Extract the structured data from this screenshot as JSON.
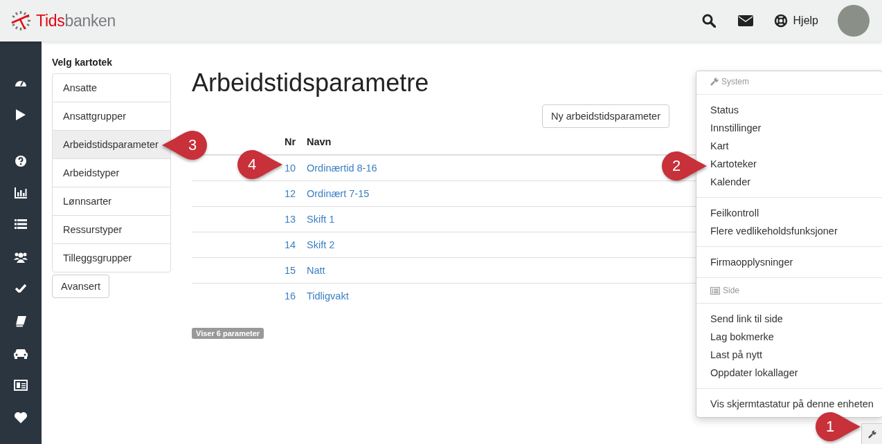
{
  "header": {
    "logo": {
      "part_1": "Tids",
      "part_2": "banken"
    },
    "help_label": "Hjelp"
  },
  "left_panel": {
    "title": "Velg kartotek",
    "items": [
      {
        "label": "Ansatte",
        "selected": false
      },
      {
        "label": "Ansattgrupper",
        "selected": false
      },
      {
        "label": "Arbeidstidsparameter",
        "selected": true
      },
      {
        "label": "Arbeidstyper",
        "selected": false
      },
      {
        "label": "Lønnsarter",
        "selected": false
      },
      {
        "label": "Ressurstyper",
        "selected": false
      },
      {
        "label": "Tilleggsgrupper",
        "selected": false
      }
    ],
    "advanced_button": "Avansert"
  },
  "main": {
    "title": "Arbeidstidsparametre",
    "new_button": "Ny arbeidstidsparameter",
    "table": {
      "columns": [
        "Nr",
        "Navn"
      ],
      "rows": [
        [
          "10",
          "Ordinærtid 8-16"
        ],
        [
          "12",
          "Ordinært 7-15"
        ],
        [
          "13",
          "Skift 1"
        ],
        [
          "14",
          "Skift 2"
        ],
        [
          "15",
          "Natt"
        ],
        [
          "16",
          "Tidligvakt"
        ]
      ]
    },
    "count_badge": "Viser 6 parameter"
  },
  "menu": {
    "groups": [
      {
        "kind": "header",
        "label": "System"
      },
      {
        "kind": "items",
        "items": [
          "Status",
          "Innstillinger",
          "Kart",
          "Kartoteker",
          "Kalender"
        ]
      },
      {
        "kind": "items",
        "items": [
          "Feilkontroll",
          "Flere vedlikeholdsfunksjoner"
        ]
      },
      {
        "kind": "items",
        "items": [
          "Firmaopplysninger"
        ]
      },
      {
        "kind": "header",
        "label": "Side"
      },
      {
        "kind": "items",
        "items": [
          "Send link til side",
          "Lag bokmerke",
          "Last på nytt",
          "Oppdater lokallager"
        ]
      },
      {
        "kind": "items",
        "items": [
          "Vis skjermtastatur på denne enheten"
        ]
      }
    ]
  },
  "callouts": [
    {
      "label": "1"
    },
    {
      "label": "2"
    },
    {
      "label": "3"
    },
    {
      "label": "4"
    }
  ]
}
